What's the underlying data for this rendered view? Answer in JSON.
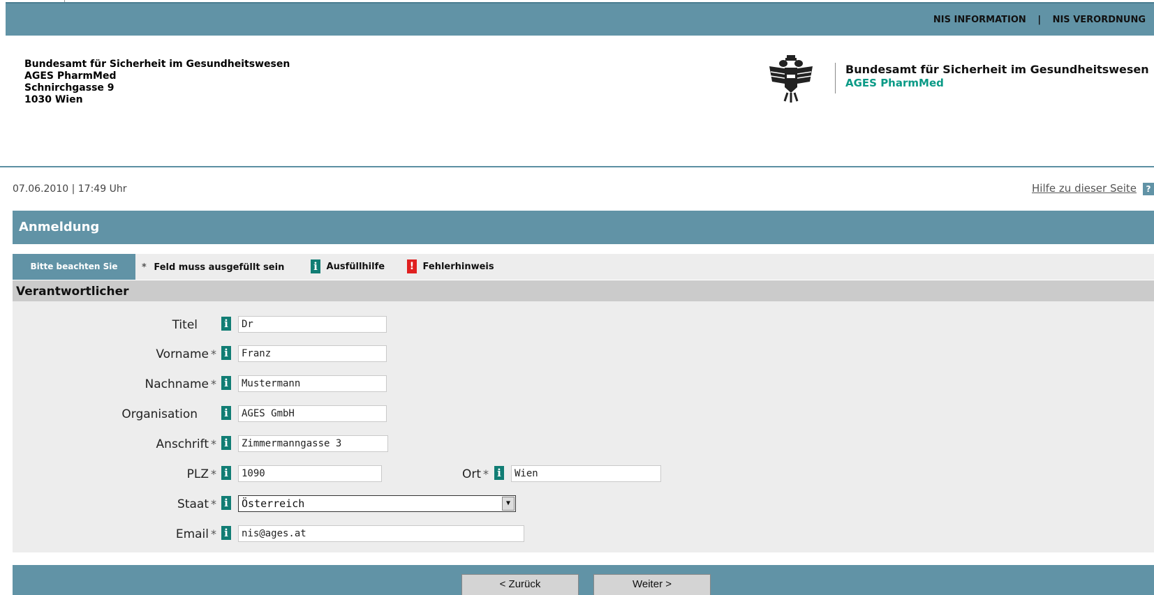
{
  "topnav": {
    "item1": "NIS INFORMATION",
    "separator": "|",
    "item2": "NIS VERORDNUNG"
  },
  "address": {
    "line1": "Bundesamt für Sicherheit im Gesundheitswesen",
    "line2": "AGES PharmMed",
    "line3": "Schnirchgasse 9",
    "line4": "1030 Wien"
  },
  "brand": {
    "line1": "Bundesamt für Sicherheit im Gesundheitswesen",
    "line2": "AGES PharmMed",
    "emblem_icon": "austrian-eagle-icon"
  },
  "datetime": "07.06.2010 | 17:49 Uhr",
  "help": {
    "label": "Hilfe zu dieser Seite",
    "icon": "?"
  },
  "page_title": "Anmeldung",
  "notice": {
    "tag": "Bitte beachten Sie",
    "required_symbol": "*",
    "required_text": "Feld muss ausgefüllt sein",
    "info_symbol": "i",
    "info_text": "Ausfüllhilfe",
    "error_symbol": "!",
    "error_text": "Fehlerhinweis"
  },
  "section_title": "Verantwortlicher",
  "form": {
    "info_symbol": "i",
    "required_symbol": "*",
    "titel": {
      "label": "Titel",
      "value": "Dr"
    },
    "vorname": {
      "label": "Vorname",
      "value": "Franz"
    },
    "nachname": {
      "label": "Nachname",
      "value": "Mustermann"
    },
    "organisation": {
      "label": "Organisation",
      "value": "AGES GmbH"
    },
    "anschrift": {
      "label": "Anschrift",
      "value": "Zimmermanngasse 3"
    },
    "plz": {
      "label": "PLZ",
      "value": "1090"
    },
    "ort": {
      "label": "Ort",
      "value": "Wien"
    },
    "staat": {
      "label": "Staat",
      "value": "Österreich",
      "arrow": "▼"
    },
    "email": {
      "label": "Email",
      "value": "nis@ages.at"
    }
  },
  "buttons": {
    "back": "< Zurück",
    "next": "Weiter >"
  },
  "colors": {
    "bar": "#6193a6",
    "info": "#117d74",
    "error": "#e02020",
    "brand_green": "#0a9a86"
  }
}
